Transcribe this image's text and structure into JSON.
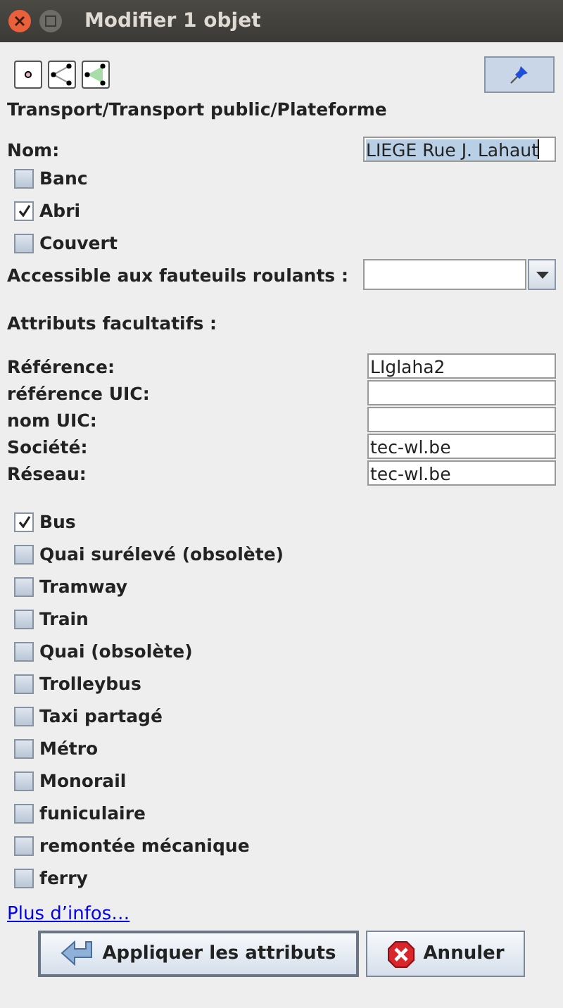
{
  "window": {
    "title": "Modifier 1 objet"
  },
  "pin": {
    "pressed": true
  },
  "preset_path": "Transport/Transport public/Plateforme",
  "name_field": {
    "label": "Nom:",
    "value": "LIEGE Rue J. Lahaut",
    "text_selected": true
  },
  "top_checks": [
    {
      "label": "Banc",
      "checked": false
    },
    {
      "label": "Abri",
      "checked": true
    },
    {
      "label": "Couvert",
      "checked": false
    }
  ],
  "wheelchair": {
    "label": "Accessible aux fauteuils roulants :"
  },
  "optional_heading": "Attributs facultatifs :",
  "optional_fields": [
    {
      "label": "Référence:",
      "value": "LIglaha2"
    },
    {
      "label": "référence UIC:"
    },
    {
      "label": "nom UIC:"
    },
    {
      "label": "Société:",
      "value": "tec-wl.be"
    },
    {
      "label": "Réseau:",
      "value": "tec-wl.be"
    }
  ],
  "mode_checks": [
    {
      "label": "Bus",
      "checked": true
    },
    {
      "label": "Quai surélevé (obsolète)",
      "checked": false
    },
    {
      "label": "Tramway",
      "checked": false
    },
    {
      "label": "Train",
      "checked": false
    },
    {
      "label": "Quai (obsolète)",
      "checked": false
    },
    {
      "label": "Trolleybus",
      "checked": false
    },
    {
      "label": "Taxi partagé",
      "checked": false
    },
    {
      "label": "Métro",
      "checked": false
    },
    {
      "label": "Monorail",
      "checked": false
    },
    {
      "label": "funiculaire",
      "checked": false
    },
    {
      "label": "remontée mécanique",
      "checked": false
    },
    {
      "label": "ferry",
      "checked": false
    }
  ],
  "more_link": "Plus d’infos…",
  "buttons": [
    {
      "label": "Appliquer les attributs",
      "kind": "apply"
    },
    {
      "label": "Annuler",
      "kind": "cancel"
    }
  ]
}
